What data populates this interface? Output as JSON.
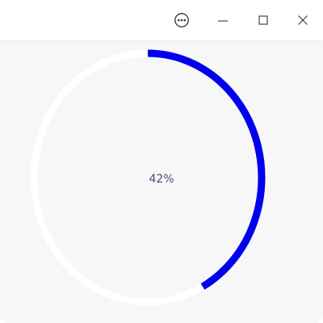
{
  "window": {
    "controls": {
      "more_icon": "more-horizontal-circle",
      "minimize_icon": "minimize",
      "maximize_icon": "maximize",
      "close_icon": "close"
    }
  },
  "progress": {
    "value": 0.42,
    "label": "42%",
    "colors": {
      "progress": "#0000ee",
      "track": "#ffffff",
      "label": "#4a4a78",
      "background": "#f7f7f7"
    }
  }
}
